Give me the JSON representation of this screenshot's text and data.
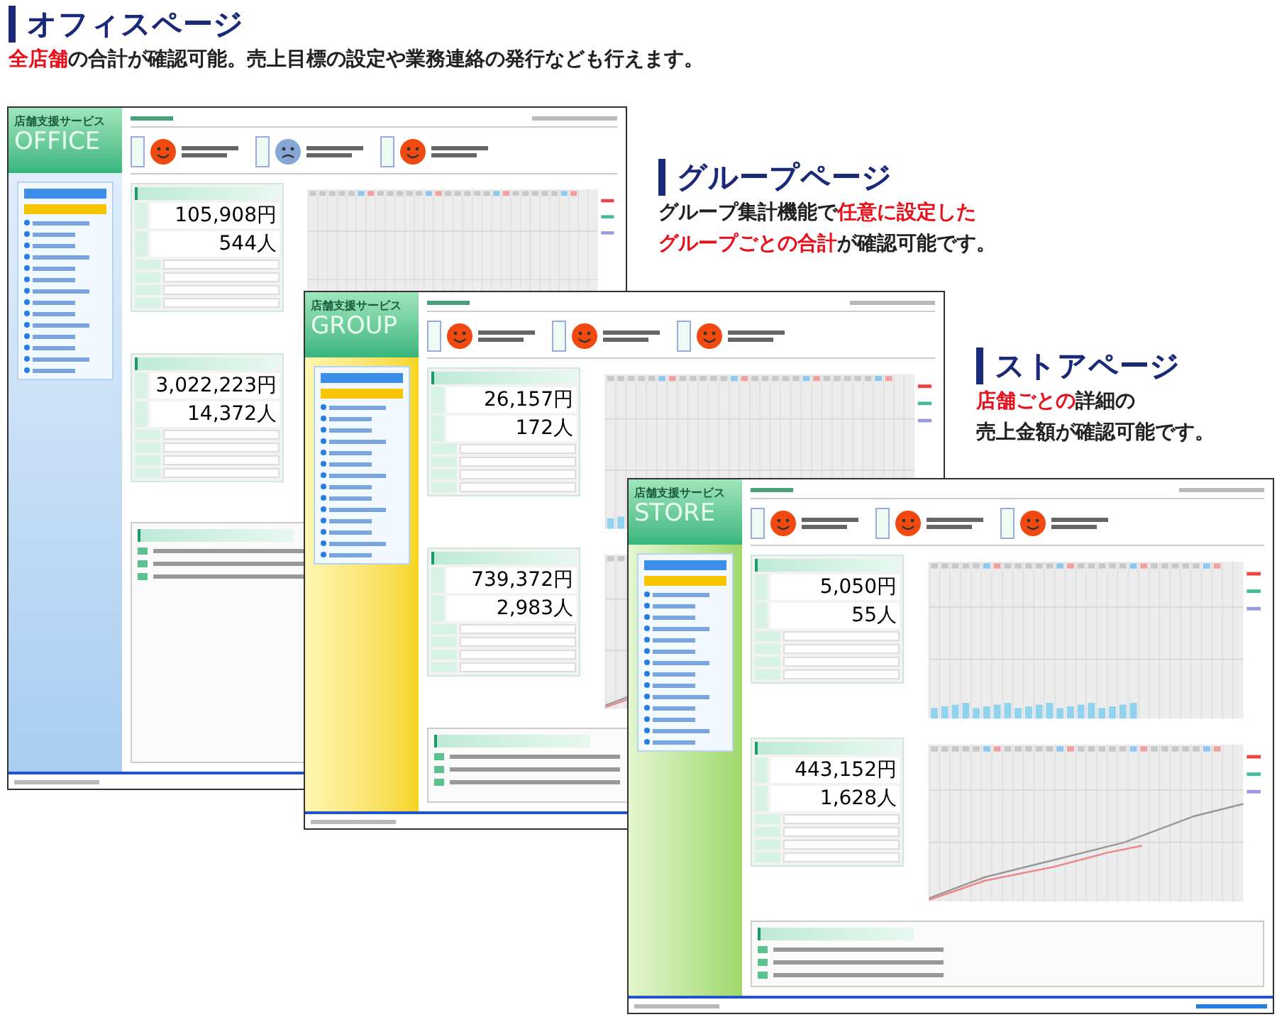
{
  "headings": [
    {
      "kind": "office",
      "title": "オフィスページ",
      "lines": [
        [
          {
            "text": "全店舗",
            "highlight": true
          },
          {
            "text": "の合計が確認可能。売上目標の設定や業務連絡の発行なども行えます。",
            "highlight": false
          }
        ]
      ]
    },
    {
      "kind": "group",
      "title": "グループページ",
      "lines": [
        [
          {
            "text": "グループ集計機能で",
            "highlight": false
          },
          {
            "text": "任意に設定した",
            "highlight": true
          }
        ],
        [
          {
            "text": "グループごとの合計",
            "highlight": true
          },
          {
            "text": "が確認可能です。",
            "highlight": false
          }
        ]
      ]
    },
    {
      "kind": "store",
      "title": "ストアページ",
      "lines": [
        [
          {
            "text": "店舗ごとの",
            "highlight": true
          },
          {
            "text": "詳細の",
            "highlight": false
          }
        ],
        [
          {
            "text": "売上金額が確認可能です。",
            "highlight": false
          }
        ]
      ]
    }
  ],
  "screens": [
    {
      "kind": "office",
      "brand": "店舗支援サービス",
      "name": "OFFICE",
      "moods": [
        {
          "kind": "good"
        },
        {
          "kind": "bad"
        },
        {
          "kind": "good"
        }
      ],
      "today": {
        "sales": "105,908円",
        "customers": "544人"
      },
      "month": {
        "sales": "3,022,223円",
        "customers": "14,372人"
      }
    },
    {
      "kind": "group",
      "brand": "店舗支援サービス",
      "name": "GROUP",
      "moods": [
        {
          "kind": "good"
        },
        {
          "kind": "good"
        },
        {
          "kind": "good"
        }
      ],
      "today": {
        "sales": "26,157円",
        "customers": "172人"
      },
      "month": {
        "sales": "739,372円",
        "customers": "2,983人"
      }
    },
    {
      "kind": "store",
      "brand": "店舗支援サービス",
      "name": "STORE",
      "moods": [
        {
          "kind": "good"
        },
        {
          "kind": "good"
        },
        {
          "kind": "good"
        }
      ],
      "today": {
        "sales": "5,050円",
        "customers": "55人"
      },
      "month": {
        "sales": "443,152円",
        "customers": "1,628人"
      }
    }
  ]
}
